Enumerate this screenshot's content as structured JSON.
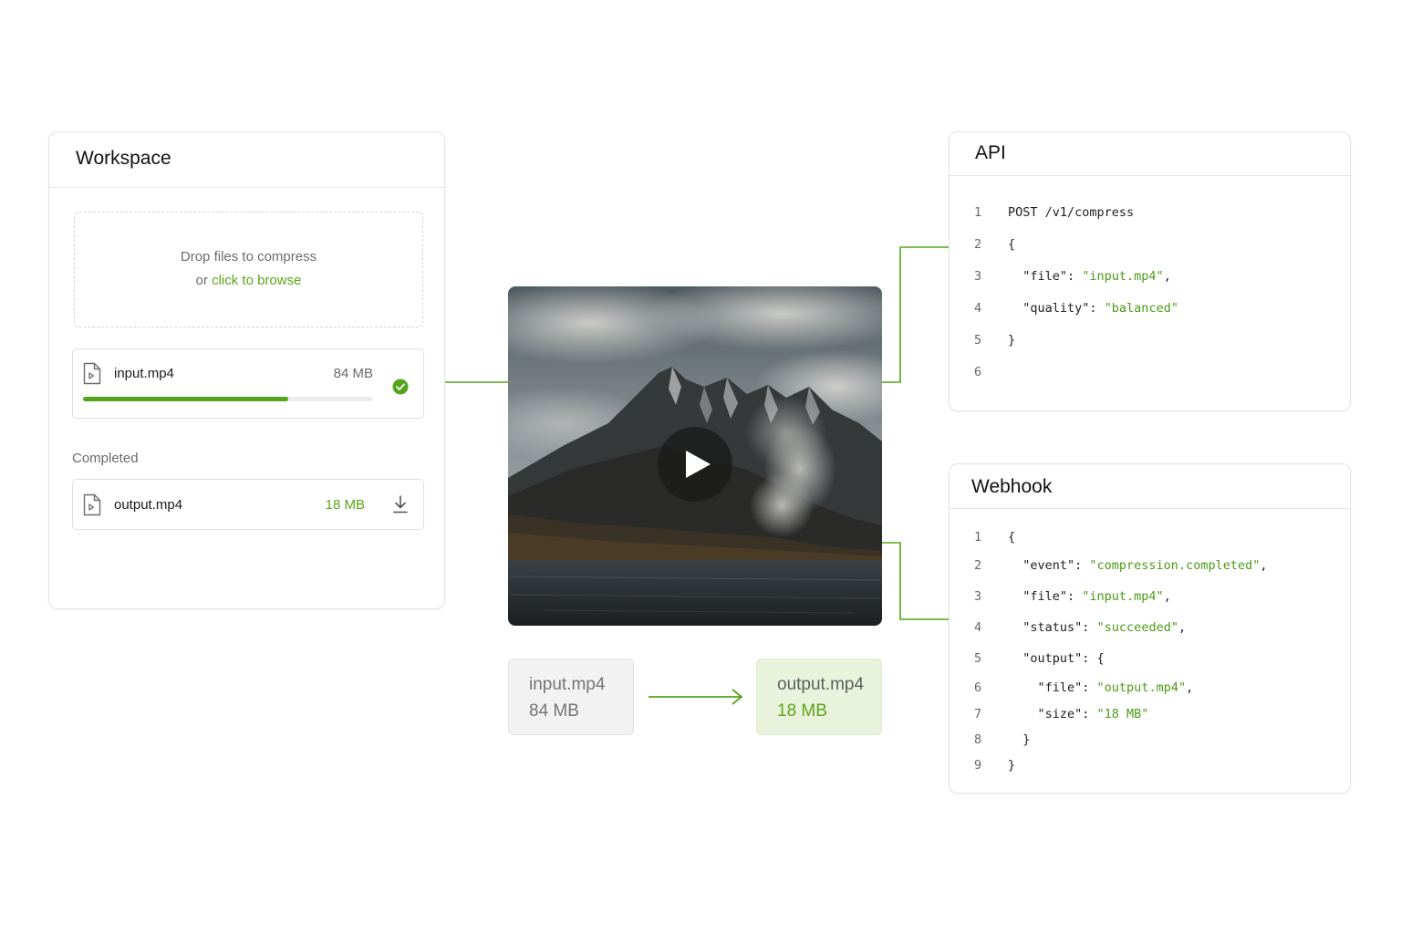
{
  "workspace": {
    "title": "Workspace",
    "dropzone": {
      "line1": "Drop files to compress",
      "line2_prefix": "or ",
      "line2_link": "click to browse"
    },
    "uploading": {
      "name": "input.mp4",
      "size": "84 MB",
      "progress": 0.71,
      "status": "complete"
    },
    "completed_label": "Completed",
    "completed": {
      "name": "output.mp4",
      "size": "18 MB"
    }
  },
  "comparison": {
    "input": {
      "name": "input.mp4",
      "size": "84 MB"
    },
    "output": {
      "name": "output.mp4",
      "size": "18 MB"
    }
  },
  "api": {
    "title": "API",
    "lines": [
      {
        "n": "1",
        "parts": [
          {
            "t": "POST /v1/compress"
          }
        ]
      },
      {
        "n": "2",
        "parts": [
          {
            "t": "{"
          }
        ]
      },
      {
        "n": "3",
        "parts": [
          {
            "t": "  \"file\": "
          },
          {
            "t": "\"input.mp4\"",
            "s": true
          },
          {
            "t": ","
          }
        ]
      },
      {
        "n": "4",
        "parts": [
          {
            "t": "  \"quality\": "
          },
          {
            "t": "\"balanced\"",
            "s": true
          }
        ]
      },
      {
        "n": "5",
        "parts": [
          {
            "t": "}"
          }
        ]
      },
      {
        "n": "6",
        "parts": []
      }
    ]
  },
  "webhook": {
    "title": "Webhook",
    "lines": [
      {
        "n": "1",
        "parts": [
          {
            "t": "{"
          }
        ]
      },
      {
        "n": "2",
        "parts": [
          {
            "t": "  \"event\": "
          },
          {
            "t": "\"compression.completed\"",
            "s": true
          },
          {
            "t": ","
          }
        ]
      },
      {
        "n": "3",
        "parts": [
          {
            "t": "  \"file\": "
          },
          {
            "t": "\"input.mp4\"",
            "s": true
          },
          {
            "t": ","
          }
        ]
      },
      {
        "n": "4",
        "parts": [
          {
            "t": "  \"status\": "
          },
          {
            "t": "\"succeeded\"",
            "s": true
          },
          {
            "t": ","
          }
        ]
      },
      {
        "n": "5",
        "parts": [
          {
            "t": "  \"output\": {"
          }
        ]
      },
      {
        "n": "6",
        "parts": [
          {
            "t": "    \"file\": "
          },
          {
            "t": "\"output.mp4\"",
            "s": true
          },
          {
            "t": ","
          }
        ]
      },
      {
        "n": "7",
        "parts": [
          {
            "t": "    \"size\": "
          },
          {
            "t": "\"18 MB\"",
            "s": true
          }
        ]
      },
      {
        "n": "8",
        "parts": [
          {
            "t": "  }"
          }
        ]
      },
      {
        "n": "9",
        "parts": [
          {
            "t": "}"
          }
        ]
      }
    ]
  },
  "icons": {
    "file": "file-video-icon",
    "check": "check-circle-icon",
    "download": "download-icon",
    "play": "play-icon",
    "arrow": "arrow-right-icon"
  },
  "colors": {
    "accent": "#55a51c",
    "string": "#4c9a17",
    "output_bg": "#e9f3db",
    "input_bg": "#f2f2f2"
  }
}
